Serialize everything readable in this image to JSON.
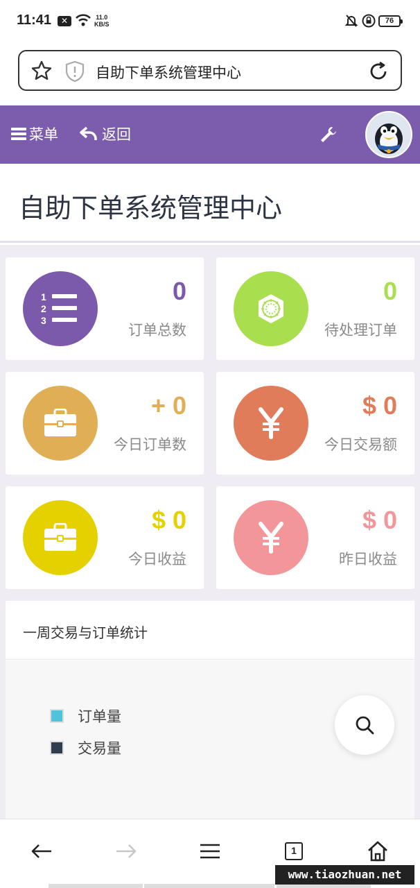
{
  "status_bar": {
    "time": "11:41",
    "net_speed_value": "11.0",
    "net_speed_unit": "KB/S",
    "battery": "76"
  },
  "url_bar": {
    "page_title": "自助下单系统管理中心",
    "icons": [
      "star-icon",
      "shield-icon",
      "reload-icon"
    ]
  },
  "nav": {
    "menu_label": "菜单",
    "back_label": "返回",
    "icons": [
      "hamburger-icon",
      "back-arrow-icon",
      "wrench-icon",
      "avatar-penguin"
    ],
    "color": "#7c5cad"
  },
  "page": {
    "title": "自助下单系统管理中心"
  },
  "stats": [
    {
      "label": "订单总数",
      "value": "0",
      "icon": "numbered-list-icon",
      "color": "#7b5aab"
    },
    {
      "label": "待处理订单",
      "value": "0",
      "icon": "gear-badge-icon",
      "color": "#a9df4f"
    },
    {
      "label": "今日订单数",
      "value": "+ 0",
      "icon": "briefcase-icon",
      "color": "#dfae55"
    },
    {
      "label": "今日交易额",
      "value": "$ 0",
      "icon": "yen-icon",
      "color": "#e07c59"
    },
    {
      "label": "今日收益",
      "value": "$ 0",
      "icon": "briefcase-icon",
      "color": "#e5d000"
    },
    {
      "label": "昨日收益",
      "value": "$ 0",
      "icon": "yen-icon",
      "color": "#f2969a"
    }
  ],
  "chart": {
    "title": "一周交易与订单统计",
    "legend": [
      {
        "name": "订单量",
        "color": "#4fc3d9"
      },
      {
        "name": "交易量",
        "color": "#2f3e4e"
      }
    ]
  },
  "bottom_bar": {
    "tab_count": "1",
    "icons": [
      "back-icon",
      "forward-icon",
      "menu-icon",
      "tabs-icon",
      "home-icon"
    ]
  },
  "watermark": "www.tiaozhuan.net"
}
